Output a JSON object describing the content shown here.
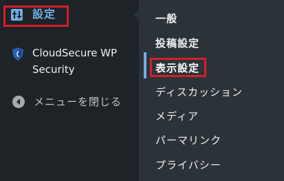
{
  "sidebar": {
    "settings_label": "設定",
    "cloudsecure_label": "CloudSecure WP Security",
    "collapse_label": "メニューを閉じる"
  },
  "submenu": {
    "items": [
      {
        "label": "一般"
      },
      {
        "label": "投稿設定"
      },
      {
        "label": "表示設定"
      },
      {
        "label": "ディスカッション"
      },
      {
        "label": "メディア"
      },
      {
        "label": "パーマリンク"
      },
      {
        "label": "プライバシー"
      }
    ],
    "current": "表示設定"
  },
  "colors": {
    "menu_bg": "#1d2327",
    "flyout_bg": "#2c3338",
    "accent": "#72aee6",
    "highlight": "#d61f2b"
  },
  "icons": {
    "settings": "settings-sliders-icon",
    "cloudsecure": "shield-icon",
    "collapse": "collapse-arrow-icon"
  }
}
